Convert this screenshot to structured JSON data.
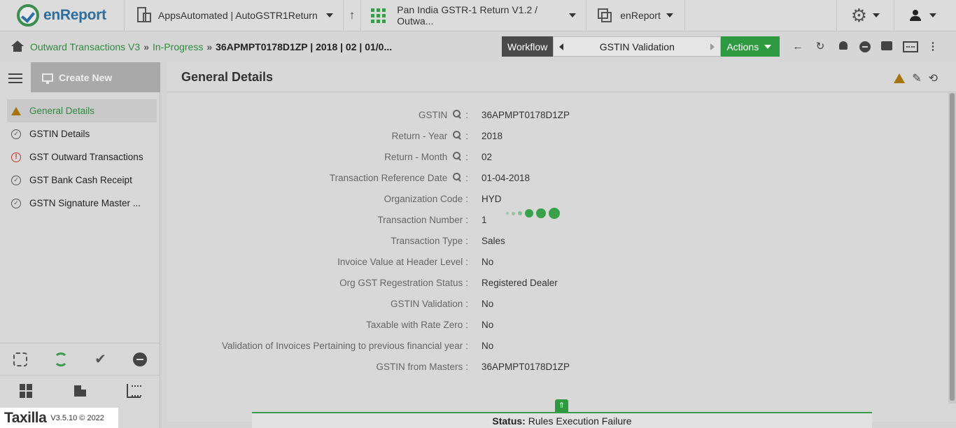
{
  "header": {
    "logo_text": "enReport",
    "app_selector": "AppsAutomated | AutoGSTR1Return",
    "report_selector": "Pan India GSTR-1 Return V1.2 / Outwa...",
    "context_selector": "enReport"
  },
  "breadcrumb": {
    "item1": "Outward Transactions V3",
    "item2": "In-Progress",
    "current": "36APMPT0178D1ZP | 2018 | 02 | 01/0...",
    "sep": "»"
  },
  "workflow": {
    "label": "Workflow",
    "stage": "GSTIN Validation",
    "actions_label": "Actions"
  },
  "sidebar": {
    "create_new": "Create New",
    "items": [
      {
        "label": "General Details",
        "state": "warning"
      },
      {
        "label": "GSTIN Details",
        "state": "ok"
      },
      {
        "label": "GST Outward Transactions",
        "state": "error"
      },
      {
        "label": "GST Bank Cash Receipt",
        "state": "ok"
      },
      {
        "label": "GSTN Signature Master ...",
        "state": "ok"
      }
    ]
  },
  "brand": {
    "name": "Taxilla",
    "version": "V3.5.10 © 2022"
  },
  "main": {
    "title": "General Details",
    "fields": [
      {
        "label": "GSTIN",
        "value": "36APMPT0178D1ZP",
        "key": true
      },
      {
        "label": "Return - Year",
        "value": "2018",
        "key": true
      },
      {
        "label": "Return - Month",
        "value": "02",
        "key": true
      },
      {
        "label": "Transaction Reference Date",
        "value": "01-04-2018",
        "key": true
      },
      {
        "label": "Organization Code",
        "value": "HYD",
        "key": false
      },
      {
        "label": "Transaction Number",
        "value": "1",
        "key": false
      },
      {
        "label": "Transaction Type",
        "value": "Sales",
        "key": false
      },
      {
        "label": "Invoice Value at Header Level",
        "value": "No",
        "key": false
      },
      {
        "label": "Org GST Regestration Status",
        "value": "Registered Dealer",
        "key": false
      },
      {
        "label": "GSTIN Validation",
        "value": "No",
        "key": false
      },
      {
        "label": "Taxable with Rate Zero",
        "value": "No",
        "key": false
      },
      {
        "label": "Validation of Invoices Pertaining to previous financial year",
        "value": "No",
        "key": false
      },
      {
        "label": "GSTIN from Masters",
        "value": "36APMPT0178D1ZP",
        "key": false
      }
    ],
    "colon": ":"
  },
  "status": {
    "prefix": "Status:",
    "text": "Rules Execution Failure"
  },
  "colors": {
    "accent_green": "#2e9a3f",
    "link_green": "#2e8a3e",
    "warning": "#a8740f",
    "error": "#c0392b"
  }
}
